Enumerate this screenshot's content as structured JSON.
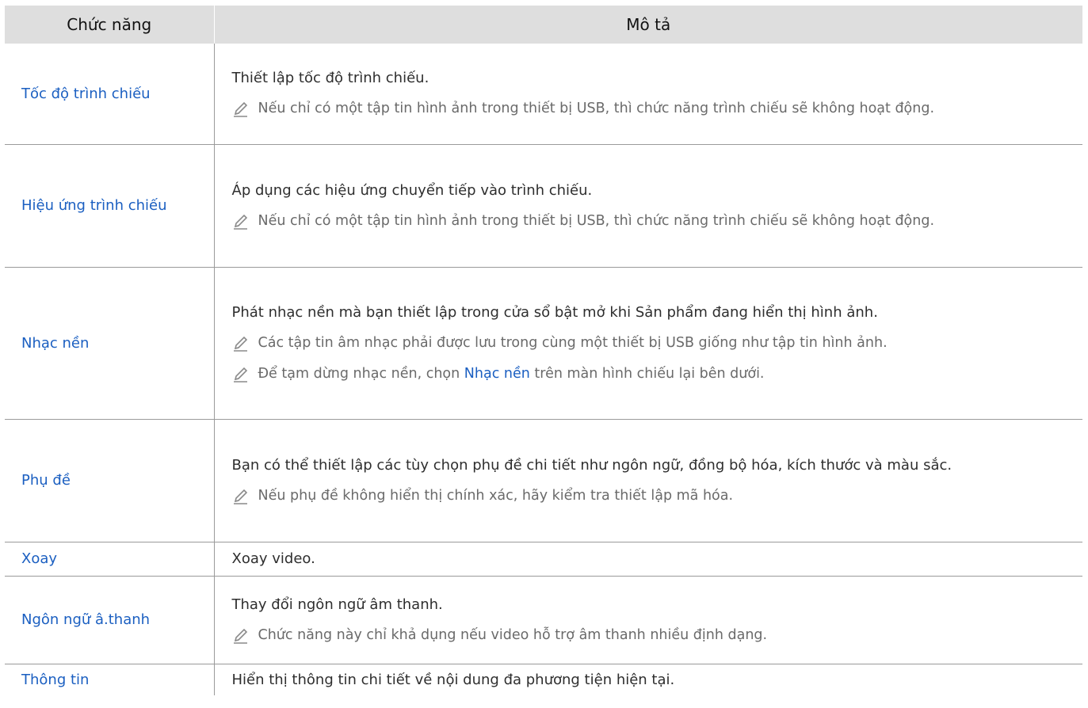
{
  "header": {
    "col_function": "Chức năng",
    "col_description": "Mô tả"
  },
  "rows": [
    {
      "name": "Tốc độ trình chiếu",
      "description": "Thiết lập tốc độ trình chiếu.",
      "notes": [
        "Nếu chỉ có một tập tin hình ảnh trong thiết bị USB, thì chức năng trình chiếu sẽ không hoạt động."
      ]
    },
    {
      "name": "Hiệu ứng trình chiếu",
      "description": "Áp dụng các hiệu ứng chuyển tiếp vào trình chiếu.",
      "notes": [
        "Nếu chỉ có một tập tin hình ảnh trong thiết bị USB, thì chức năng trình chiếu sẽ không hoạt động."
      ]
    },
    {
      "name": "Nhạc nền",
      "description": "Phát nhạc nền mà bạn thiết lập trong cửa sổ bật mở khi Sản phẩm đang hiển thị hình ảnh.",
      "notes": [
        "Các tập tin âm nhạc phải được lưu trong cùng một thiết bị USB giống như tập tin hình ảnh."
      ],
      "note_split": {
        "before": "Để tạm dừng nhạc nền, chọn ",
        "highlight": "Nhạc nền",
        "after": " trên màn hình chiếu lại bên dưới."
      }
    },
    {
      "name": "Phụ đề",
      "description": "Bạn có thể thiết lập các tùy chọn phụ đề chi tiết như ngôn ngữ, đồng bộ hóa, kích thước và màu sắc.",
      "notes": [
        "Nếu phụ đề không hiển thị chính xác, hãy kiểm tra thiết lập mã hóa."
      ]
    },
    {
      "name": "Xoay",
      "description": "Xoay video.",
      "notes": []
    },
    {
      "name": "Ngôn ngữ â.thanh",
      "description": "Thay đổi ngôn ngữ âm thanh.",
      "notes": [
        "Chức năng này chỉ khả dụng nếu video hỗ trợ âm thanh nhiều định dạng."
      ]
    },
    {
      "name": "Thông tin",
      "description": "Hiển thị thông tin chi tiết về nội dung đa phương tiện hiện tại.",
      "notes": []
    }
  ],
  "icons": {
    "note": "pencil-note-icon"
  },
  "colors": {
    "link_blue": "#1b5fc1",
    "header_bg": "#dedede",
    "note_text": "#6a6a6a"
  }
}
